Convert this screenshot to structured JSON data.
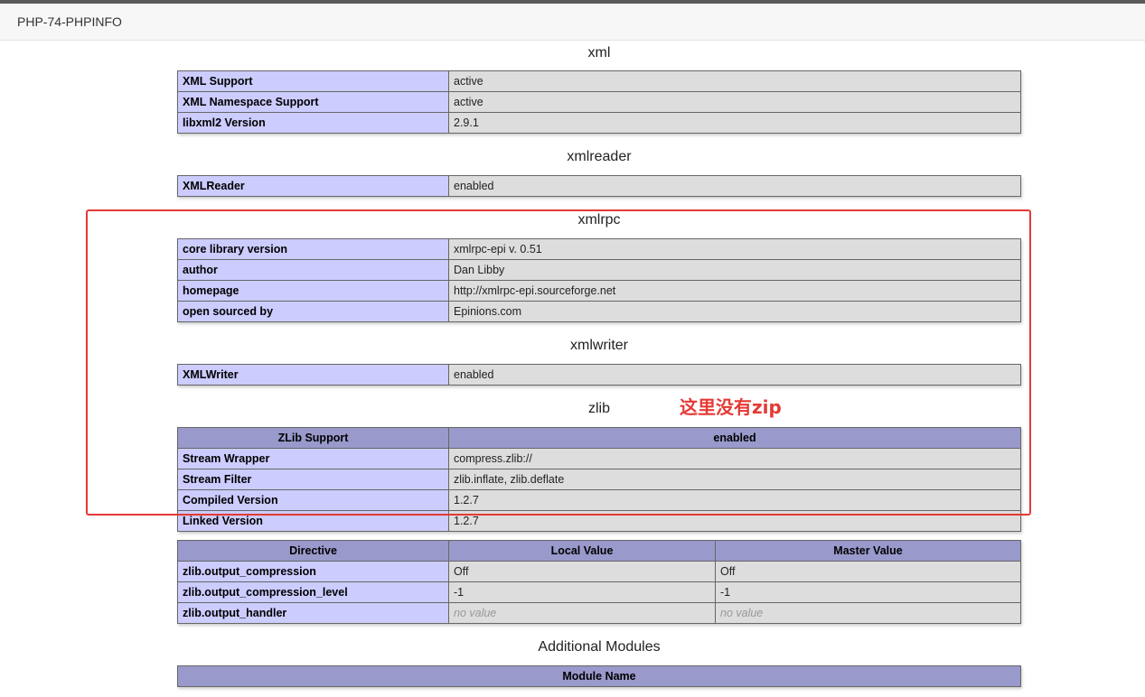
{
  "window": {
    "tab_title": "PHP-74-PHPINFO"
  },
  "sections": {
    "xml": {
      "title": "xml",
      "rows": [
        {
          "name": "XML Support",
          "value": "active"
        },
        {
          "name": "XML Namespace Support",
          "value": "active"
        },
        {
          "name": "libxml2 Version",
          "value": "2.9.1"
        }
      ]
    },
    "xmlreader": {
      "title": "xmlreader",
      "rows": [
        {
          "name": "XMLReader",
          "value": "enabled"
        }
      ]
    },
    "xmlrpc": {
      "title": "xmlrpc",
      "rows": [
        {
          "name": "core library version",
          "value": "xmlrpc-epi v. 0.51"
        },
        {
          "name": "author",
          "value": "Dan Libby"
        },
        {
          "name": "homepage",
          "value": "http://xmlrpc-epi.sourceforge.net"
        },
        {
          "name": "open sourced by",
          "value": "Epinions.com"
        }
      ]
    },
    "xmlwriter": {
      "title": "xmlwriter",
      "rows": [
        {
          "name": "XMLWriter",
          "value": "enabled"
        }
      ]
    },
    "zlib": {
      "title": "zlib",
      "header": {
        "name": "ZLib Support",
        "value": "enabled"
      },
      "rows": [
        {
          "name": "Stream Wrapper",
          "value": "compress.zlib://"
        },
        {
          "name": "Stream Filter",
          "value": "zlib.inflate, zlib.deflate"
        },
        {
          "name": "Compiled Version",
          "value": "1.2.7"
        },
        {
          "name": "Linked Version",
          "value": "1.2.7"
        }
      ],
      "directives": {
        "headers": [
          "Directive",
          "Local Value",
          "Master Value"
        ],
        "rows": [
          {
            "name": "zlib.output_compression",
            "local": "Off",
            "master": "Off"
          },
          {
            "name": "zlib.output_compression_level",
            "local": "-1",
            "master": "-1"
          },
          {
            "name": "zlib.output_handler",
            "local": "no value",
            "master": "no value"
          }
        ]
      }
    },
    "additional": {
      "title": "Additional Modules",
      "header": "Module Name"
    }
  },
  "annotation": {
    "text": "这里没有zip",
    "color": "#e53935"
  },
  "colors": {
    "entry_bg": "#ccccff",
    "value_bg": "#dddddd",
    "header_bg": "#9999cc"
  }
}
